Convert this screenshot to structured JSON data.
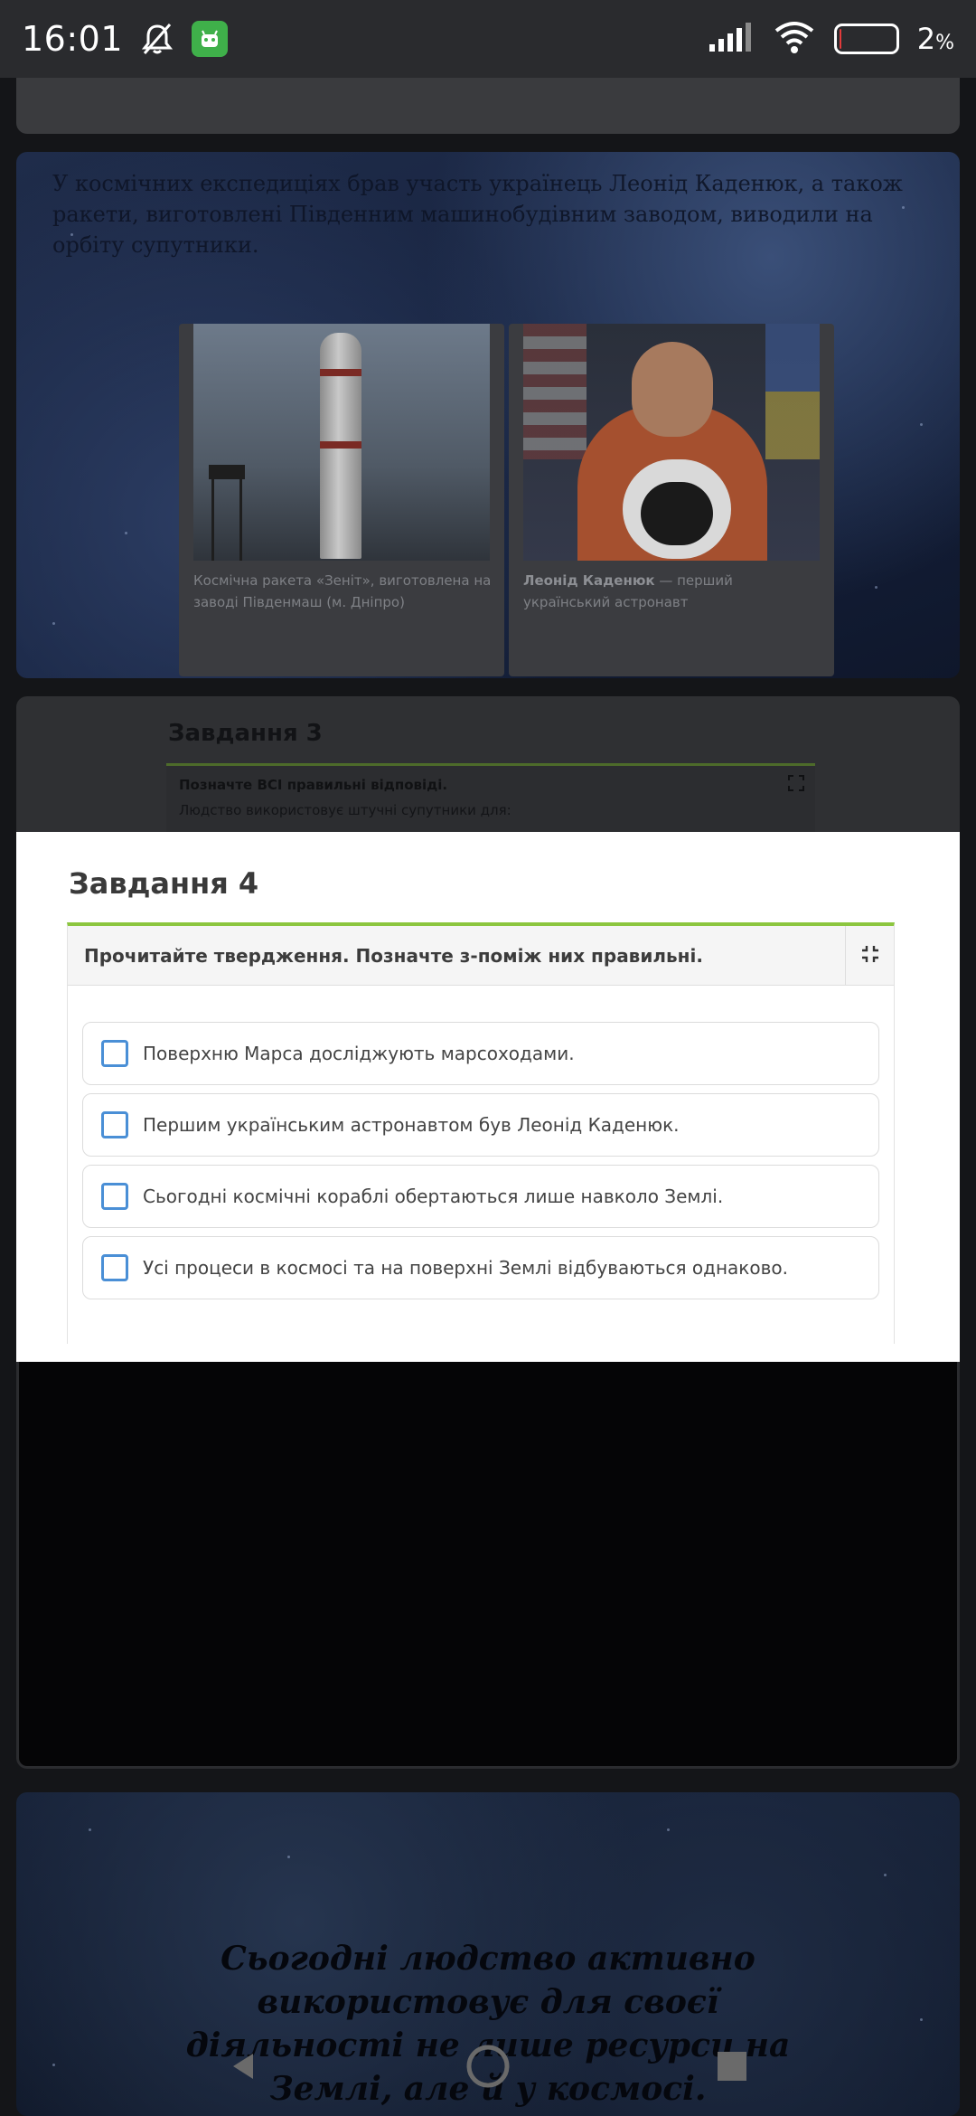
{
  "status_bar": {
    "time": "16:01",
    "battery_percent": "2",
    "battery_unit": "%",
    "battery_level": 0.02,
    "icons": [
      "bell-muted-icon",
      "android-app-icon",
      "signal-icon",
      "wifi-icon",
      "battery-icon"
    ]
  },
  "background": {
    "space_text": "У космічних експедиціях брав участь українець Леонід Каденюк, а також ракети, виготовлені Південним машинобудівним заводом, виводили на орбіту супутники.",
    "photos": [
      {
        "caption": "Космічна ракета «Зеніт», виготовлена на заводі Південмаш (м. Дніпро)"
      },
      {
        "caption_bold": "Леонід Каденюк",
        "caption_rest": " — перший український астронавт"
      }
    ],
    "task3": {
      "title": "Завдання 3",
      "question": "Позначте ВСІ правильні відповіді.",
      "sub": "Людство використовує штучні супутники для:"
    },
    "quote": "Сьогодні людство активно використовує для своєї діяльності не лише ресурси на Землі, але й у космосі."
  },
  "task4": {
    "title": "Завдання 4",
    "question": "Прочитайте твердження. Позначте з-поміж них правильні.",
    "options": [
      {
        "label": "Поверхню Марса досліджують марсоходами.",
        "checked": false
      },
      {
        "label": "Першим українським астронавтом був Леонід Каденюк.",
        "checked": false
      },
      {
        "label": "Сьогодні космічні кораблі обертаються лише навколо Землі.",
        "checked": false
      },
      {
        "label": "Усі процеси в космосі та на поверхні Землі відбуваються однаково.",
        "checked": false
      }
    ],
    "accent_color": "#8cc63f",
    "checkbox_color": "#4a8fd6"
  },
  "nav_bar": {
    "buttons": [
      "back-icon",
      "home-icon",
      "recents-icon"
    ]
  }
}
